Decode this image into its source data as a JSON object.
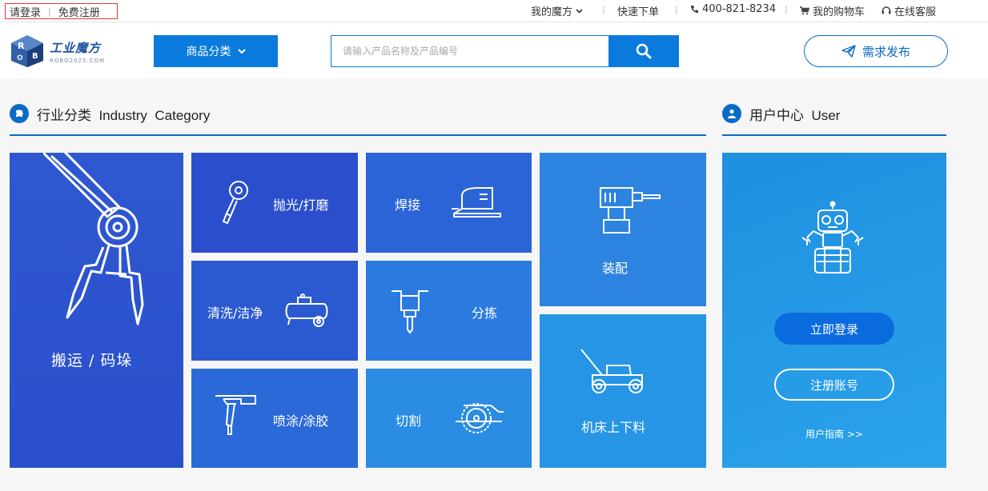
{
  "topbar": {
    "login": "请登录",
    "register": "免费注册",
    "my_cube": "我的魔方",
    "quick_order": "快速下单",
    "phone": "400-821-8234",
    "cart": "我的购物车",
    "service": "在线客服"
  },
  "header": {
    "logo_cn": "工业魔方",
    "logo_en": "ROBO2025.COM",
    "category_button": "商品分类",
    "search_placeholder": "请输入产品名称及产品编号",
    "post_button": "需求发布"
  },
  "industry": {
    "title": "行业分类  Industry  Category",
    "tiles": {
      "carry": "搬运 / 码垛",
      "polish": "抛光/打磨",
      "weld": "焊接",
      "assemble": "装配",
      "clean": "清洗/洁净",
      "sort": "分拣",
      "spray": "喷涂/涂胶",
      "cut": "切割",
      "machine": "机床上下料"
    }
  },
  "user": {
    "title": "用户中心  User",
    "login_button": "立即登录",
    "register_button": "注册账号",
    "guide": "用户指南 >>"
  },
  "colors": {
    "primary": "#0a7bdc",
    "tile_dark": "#2a4fcb",
    "tile_light": "#2a9be6"
  }
}
